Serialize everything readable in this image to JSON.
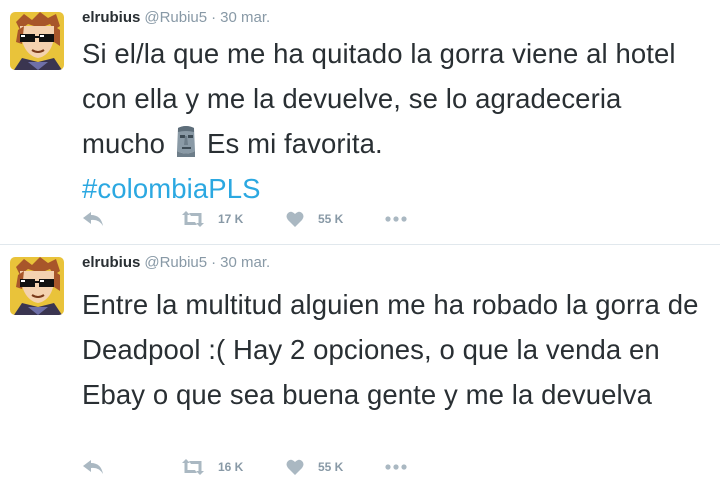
{
  "tweets": [
    {
      "name": "elrubius",
      "handle": "@Rubiu5",
      "separator": "·",
      "time": "30 mar.",
      "text_part1": "Si el/la que me ha quitado la gorra viene al hotel con ella y me la devuelve, se lo agradeceria mucho",
      "emoji": "moai-icon",
      "text_part2": "Es mi favorita.",
      "hashtag": "#colombiaPLS",
      "retweets": "17 K",
      "likes": "55 K"
    },
    {
      "name": "elrubius",
      "handle": "@Rubiu5",
      "separator": "·",
      "time": "30 mar.",
      "text": "Entre la multitud alguien me ha robado la gorra de Deadpool :( Hay 2 opciones, o que la venda en Ebay o que sea buena gente y me la devuelva",
      "retweets": "16 K",
      "likes": "55 K"
    }
  ],
  "colors": {
    "hashtag": "#2ba8e1",
    "meta": "#8899a6",
    "icon": "#aab8c2",
    "text": "#292f33"
  }
}
